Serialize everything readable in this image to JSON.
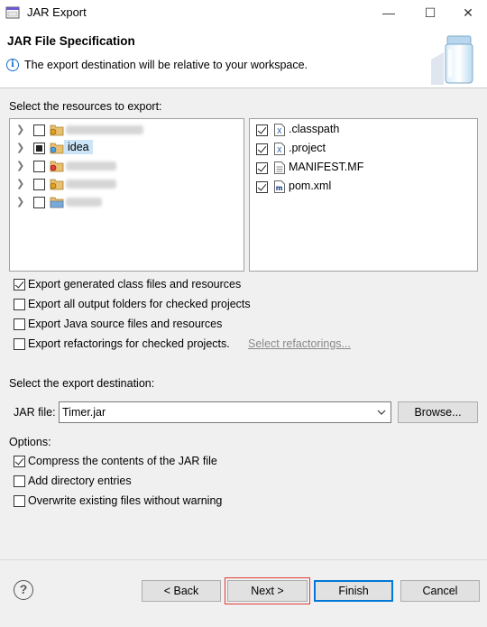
{
  "window": {
    "title": "JAR Export",
    "controls": {
      "minimize": "—",
      "maximize": "☐",
      "close": "✕"
    }
  },
  "banner": {
    "title": "JAR File Specification",
    "message": "The export destination will be relative to your workspace."
  },
  "resources": {
    "label": "Select the resources to export:",
    "tree": [
      {
        "label": "",
        "state": "unchecked",
        "redacted": true
      },
      {
        "label": "idea",
        "state": "partial",
        "redacted": false,
        "selected": true
      },
      {
        "label": "",
        "state": "unchecked",
        "redacted": true
      },
      {
        "label": "",
        "state": "unchecked",
        "redacted": true
      },
      {
        "label": "",
        "state": "unchecked",
        "redacted": true
      }
    ],
    "files": [
      {
        "label": ".classpath",
        "checked": true,
        "icon": "xml-file-icon"
      },
      {
        "label": ".project",
        "checked": true,
        "icon": "xml-file-icon"
      },
      {
        "label": "MANIFEST.MF",
        "checked": true,
        "icon": "text-file-icon"
      },
      {
        "label": "pom.xml",
        "checked": true,
        "icon": "maven-file-icon"
      }
    ]
  },
  "export_options": [
    {
      "label": "Export generated class files and resources",
      "checked": true
    },
    {
      "label": "Export all output folders for checked projects",
      "checked": false
    },
    {
      "label": "Export Java source files and resources",
      "checked": false
    },
    {
      "label": "Export refactorings for checked projects.",
      "checked": false
    }
  ],
  "select_refactorings_link": "Select refactorings...",
  "destination": {
    "label": "Select the export destination:",
    "jar_label": "JAR file:",
    "jar_value": "Timer.jar",
    "browse": "Browse..."
  },
  "options": {
    "label": "Options:",
    "items": [
      {
        "label": "Compress the contents of the JAR file",
        "checked": true
      },
      {
        "label": "Add directory entries",
        "checked": false
      },
      {
        "label": "Overwrite existing files without warning",
        "checked": false
      }
    ]
  },
  "buttons": {
    "back": "< Back",
    "next": "Next >",
    "finish": "Finish",
    "cancel": "Cancel"
  },
  "colors": {
    "accent": "#0078d7",
    "highlight": "#e03a3a",
    "selection": "#cce4f7"
  }
}
